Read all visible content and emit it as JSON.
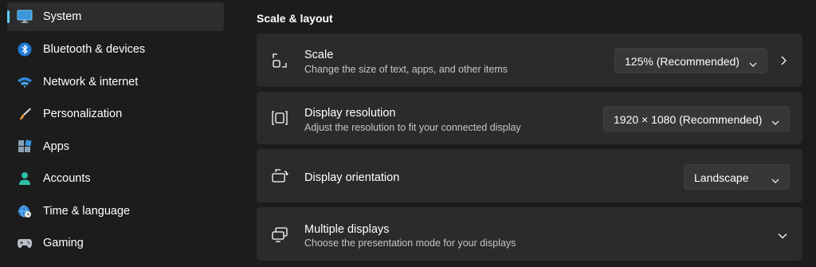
{
  "sidebar": {
    "items": [
      {
        "label": "System",
        "icon": "monitor-icon",
        "selected": true
      },
      {
        "label": "Bluetooth & devices",
        "icon": "bluetooth-icon"
      },
      {
        "label": "Network & internet",
        "icon": "wifi-icon"
      },
      {
        "label": "Personalization",
        "icon": "brush-icon"
      },
      {
        "label": "Apps",
        "icon": "apps-icon"
      },
      {
        "label": "Accounts",
        "icon": "person-icon"
      },
      {
        "label": "Time & language",
        "icon": "globe-clock-icon"
      },
      {
        "label": "Gaming",
        "icon": "gamepad-icon"
      }
    ]
  },
  "main": {
    "section_title": "Scale & layout",
    "settings": {
      "scale": {
        "title": "Scale",
        "description": "Change the size of text, apps, and other items",
        "value": "125% (Recommended)",
        "icon": "scale-icon"
      },
      "resolution": {
        "title": "Display resolution",
        "description": "Adjust the resolution to fit your connected display",
        "value": "1920 × 1080 (Recommended)",
        "icon": "resolution-icon"
      },
      "orientation": {
        "title": "Display orientation",
        "value": "Landscape",
        "icon": "orientation-icon"
      },
      "multiple": {
        "title": "Multiple displays",
        "description": "Choose the presentation mode for your displays",
        "icon": "multiple-displays-icon"
      }
    }
  },
  "colors": {
    "accent": "#60cdff",
    "background": "#1c1c1c",
    "card": "#2b2b2b"
  }
}
